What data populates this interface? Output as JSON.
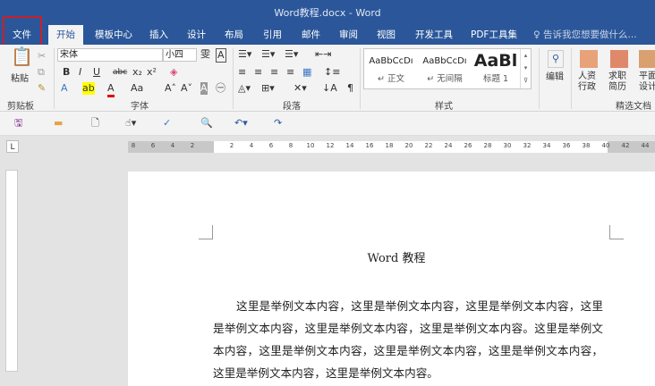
{
  "title": "Word教程.docx - Word",
  "tabs": [
    "文件",
    "开始",
    "模板中心",
    "插入",
    "设计",
    "布局",
    "引用",
    "邮件",
    "审阅",
    "视图",
    "开发工具",
    "PDF工具集"
  ],
  "tell_me": "告诉我您想要做什么...",
  "ribbon": {
    "clipboard": {
      "paste": "粘贴",
      "label": "剪贴板"
    },
    "font": {
      "name": "宋体",
      "size": "小四",
      "label": "字体",
      "bold": "B",
      "italic": "I",
      "underline": "U",
      "strike": "abc",
      "sub": "x₂",
      "sup": "x²",
      "case": "Aa"
    },
    "paragraph": {
      "label": "段落"
    },
    "styles": {
      "label": "样式",
      "items": [
        {
          "sample": "AaBbCcDı",
          "name": "↵ 正文"
        },
        {
          "sample": "AaBbCcDı",
          "name": "↵ 无间隔"
        },
        {
          "sample": "AaBl",
          "name": "标题 1"
        }
      ]
    },
    "editing": {
      "label": "编辑"
    },
    "templates": {
      "label": "精选文档",
      "items": [
        "人资\n行政",
        "求职\n简历",
        "平面\n设计"
      ]
    }
  },
  "ruler_ticks": [
    "8",
    "6",
    "4",
    "2",
    "",
    "2",
    "4",
    "6",
    "8",
    "10",
    "12",
    "14",
    "16",
    "18",
    "20",
    "22",
    "24",
    "26",
    "28",
    "30",
    "32",
    "34",
    "36",
    "38",
    "40",
    "42",
    "44"
  ],
  "document": {
    "title": "Word 教程",
    "body": "这里是举例文本内容，这里是举例文本内容，这里是举例文本内容，这里是举例文本内容，这里是举例文本内容，这里是举例文本内容。这里是举例文本内容，这里是举例文本内容，这里是举例文本内容，这里是举例文本内容，这里是举例文本内容，这里是举例文本内容。"
  },
  "colors": {
    "brand": "#2b579a",
    "highlight": "#c8202a"
  }
}
